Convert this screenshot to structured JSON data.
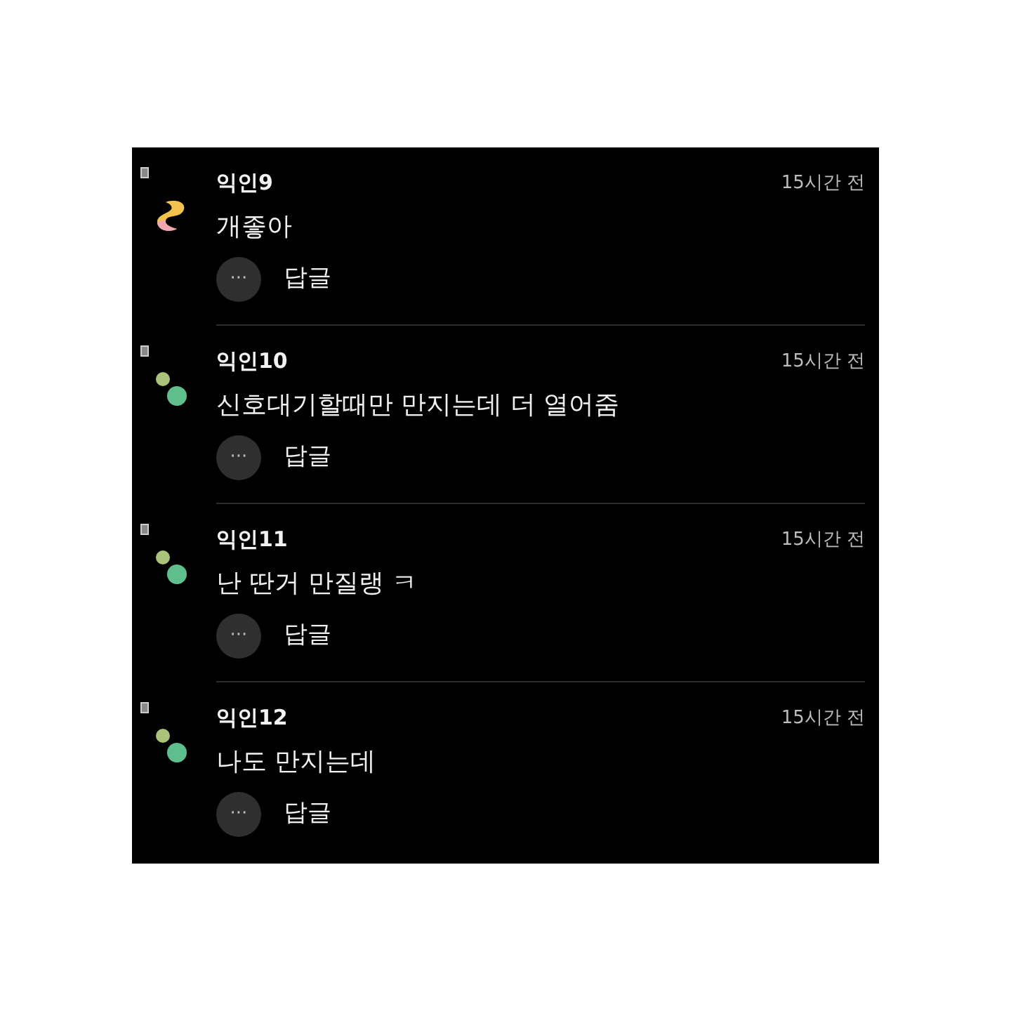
{
  "comments": [
    {
      "author": "익인9",
      "time": "15시간 전",
      "text": "개좋아",
      "more": "···",
      "reply": "답글",
      "kind": "swirl"
    },
    {
      "author": "익인10",
      "time": "15시간 전",
      "text": "신호대기할때만 만지는데 더 열어줌",
      "more": "···",
      "reply": "답글",
      "kind": "dots"
    },
    {
      "author": "익인11",
      "time": "15시간 전",
      "text": "난 딴거 만질랭 ㅋ",
      "more": "···",
      "reply": "답글",
      "kind": "dots"
    },
    {
      "author": "익인12",
      "time": "15시간 전",
      "text": "나도 만지는데",
      "more": "···",
      "reply": "답글",
      "kind": "dots"
    }
  ]
}
